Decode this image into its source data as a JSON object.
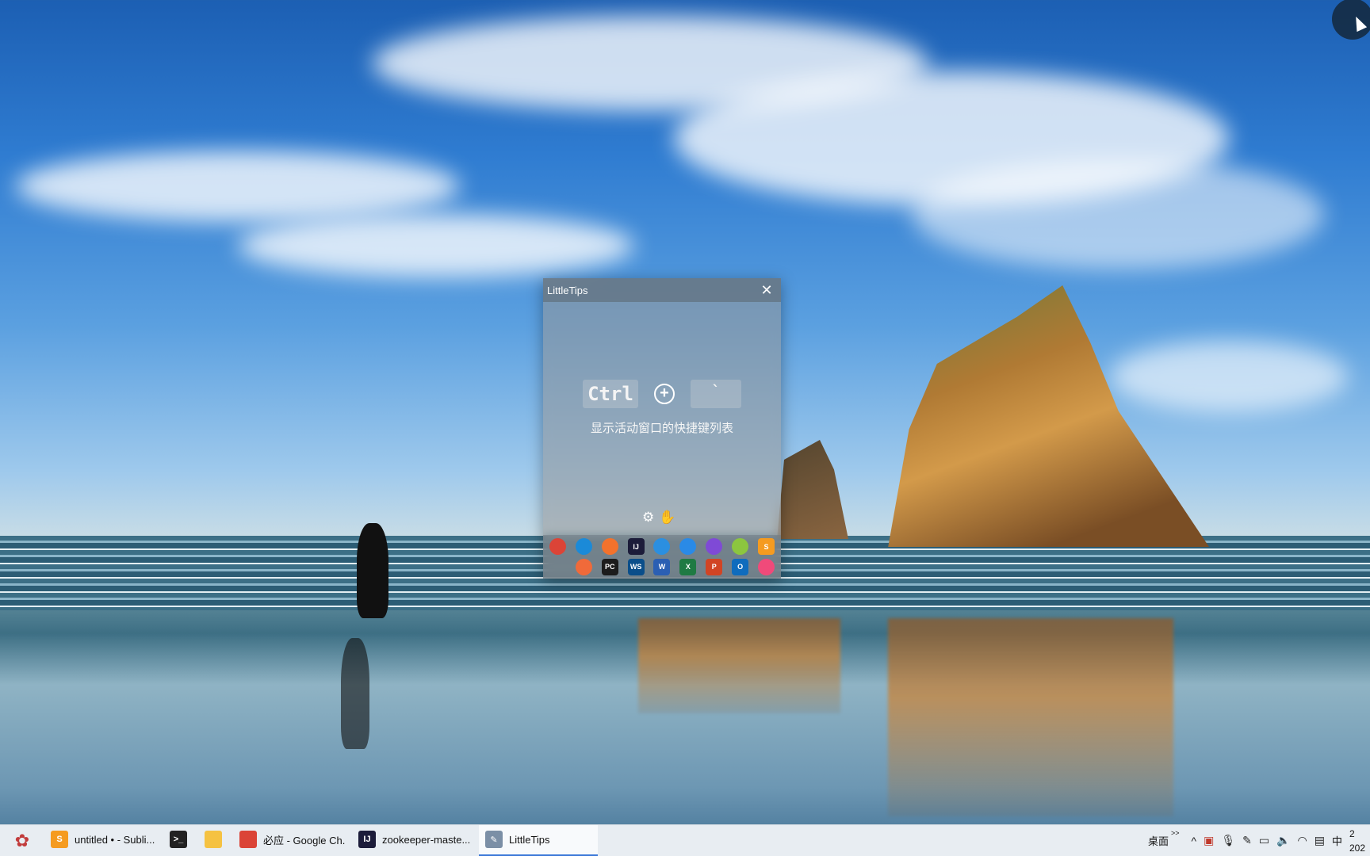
{
  "window": {
    "title": "LittleTips",
    "close_glyph": "✕",
    "shortcut": {
      "key1": "Ctrl",
      "plus": "+",
      "key2": "`"
    },
    "description": "显示活动窗口的快捷键列表",
    "tools": {
      "settings_icon": "⚙",
      "donate_icon": "hand-coin-icon"
    },
    "apps_row1": [
      {
        "name": "chrome",
        "color": "#db4437",
        "glyph": ""
      },
      {
        "name": "edge",
        "color": "#1b8ad8",
        "glyph": ""
      },
      {
        "name": "firefox",
        "color": "#f3722c",
        "glyph": ""
      },
      {
        "name": "intellij",
        "color": "#1c1c3a",
        "glyph": "IJ"
      },
      {
        "name": "vscode",
        "color": "#2b8fe0",
        "glyph": ""
      },
      {
        "name": "windows",
        "color": "#2a8ae6",
        "glyph": ""
      },
      {
        "name": "visual-studio",
        "color": "#7f4ad6",
        "glyph": ""
      },
      {
        "name": "cat-app",
        "color": "#8cc63f",
        "glyph": ""
      },
      {
        "name": "sublime",
        "color": "#f59b20",
        "glyph": "S"
      }
    ],
    "apps_row2": [
      {
        "name": "blank",
        "color": "transparent",
        "glyph": ""
      },
      {
        "name": "pen-app",
        "color": "#f06a3a",
        "glyph": ""
      },
      {
        "name": "pycharm",
        "color": "#1c1c1c",
        "glyph": "PC"
      },
      {
        "name": "webstorm",
        "color": "#0a4e8a",
        "glyph": "WS"
      },
      {
        "name": "word",
        "color": "#2b5fb3",
        "glyph": "W"
      },
      {
        "name": "excel",
        "color": "#1f7a43",
        "glyph": "X"
      },
      {
        "name": "powerpoint",
        "color": "#d14424",
        "glyph": "P"
      },
      {
        "name": "outlook",
        "color": "#0f6cbd",
        "glyph": "O"
      },
      {
        "name": "color-app",
        "color": "#f04a7a",
        "glyph": ""
      }
    ]
  },
  "taskbar": {
    "items": [
      {
        "label": "untitled • - Subli...",
        "icon_color": "#f59b20",
        "icon_glyph": "S"
      },
      {
        "label": "",
        "icon_color": "#222",
        "icon_glyph": ">_"
      },
      {
        "label": "",
        "icon_color": "#f5c242",
        "icon_glyph": ""
      },
      {
        "label": "必应 - Google Ch...",
        "icon_color": "#db4437",
        "icon_glyph": ""
      },
      {
        "label": "zookeeper-maste...",
        "icon_color": "#1c1c3a",
        "icon_glyph": "IJ"
      },
      {
        "label": "LittleTips",
        "icon_color": "#7b8fa6",
        "icon_glyph": "✎"
      }
    ],
    "tray": {
      "desktop_label": "桌面",
      "chevron": ">>",
      "caret": "^",
      "ime": "中",
      "clock_top": "2",
      "clock_bottom": "202"
    }
  }
}
